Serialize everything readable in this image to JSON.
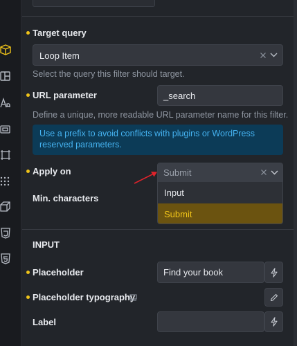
{
  "colors": {
    "accent": "#f0c419",
    "notice_bg": "#0c3b57",
    "notice_text": "#45b2f0",
    "arrow": "#e0232b"
  },
  "sidebar_icons": [
    "cube-icon",
    "layout-icon",
    "typography-icon",
    "frame-icon",
    "crop-icon",
    "grid-icon",
    "box-3d-icon",
    "css3-icon",
    "html5-icon"
  ],
  "fields": {
    "target_query": {
      "label": "Target query",
      "value": "Loop Item",
      "help": "Select the query this filter should target."
    },
    "url_parameter": {
      "label": "URL parameter",
      "value": "_search",
      "help": "Define a unique, more readable URL parameter name for this filter."
    },
    "notice": "Use a prefix to avoid conflicts with plugins or WordPress reserved parameters.",
    "apply_on": {
      "label": "Apply on",
      "value": "Submit",
      "options": [
        "Input",
        "Submit"
      ]
    },
    "min_characters": {
      "label": "Min. characters"
    }
  },
  "input_section": {
    "title": "INPUT",
    "placeholder": {
      "label": "Placeholder",
      "value": "Find your book"
    },
    "placeholder_typography": {
      "label": "Placeholder typography"
    },
    "label_field": {
      "label": "Label",
      "value": ""
    }
  }
}
